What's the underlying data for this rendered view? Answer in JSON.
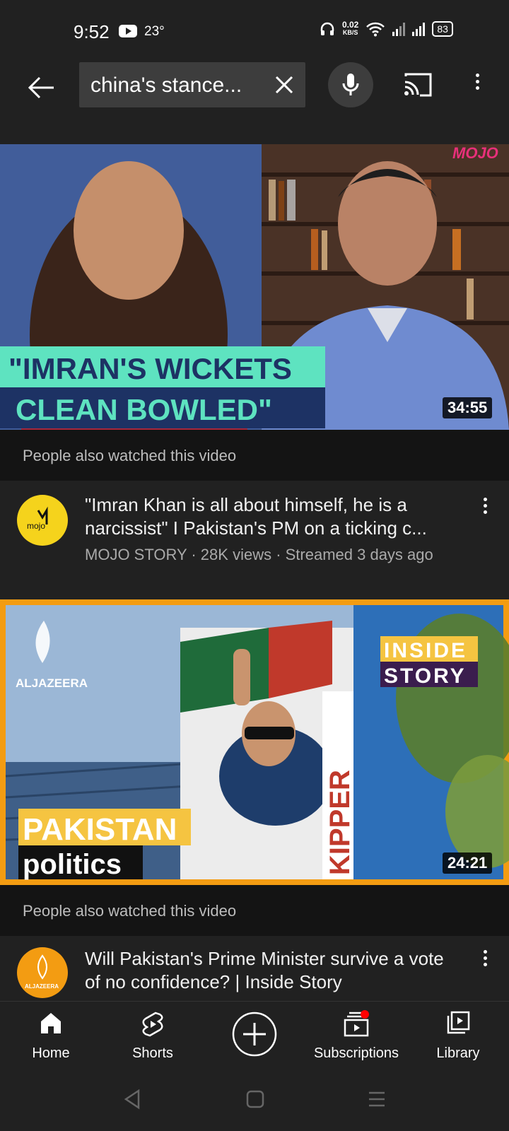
{
  "status_bar": {
    "time": "9:52",
    "temperature": "23°",
    "net_speed_value": "0.02",
    "net_speed_unit": "KB/S",
    "battery": "83"
  },
  "search": {
    "query": "china's stance...",
    "clear_icon": "close-icon",
    "mic_icon": "mic-icon"
  },
  "videos": [
    {
      "thumb_badge": "MOJO",
      "thumb_caption_line1": "\"IMRAN'S WICKETS",
      "thumb_caption_line2": "CLEAN BOWLED\"",
      "duration": "34:55",
      "also_watched": "People also watched this video",
      "avatar_text": "mojo",
      "title": "\"Imran Khan is all about himself, he is a narcissist\" I Pakistan's PM on a ticking c...",
      "meta": "MOJO STORY · 28K views · Streamed 3 days ago"
    },
    {
      "thumb_logo": "ALJAZEERA",
      "thumb_show_line1": "INSIDE",
      "thumb_show_line2": "STORY",
      "thumb_caption_line1": "PAKISTAN",
      "thumb_caption_line2": "politics",
      "thumb_banner_text": "KIPPER",
      "duration": "24:21",
      "also_watched": "People also watched this video",
      "avatar_text": "ALJAZEERA",
      "title": "Will Pakistan's Prime Minister survive a vote of no confidence? | Inside Story"
    }
  ],
  "bottom_nav": [
    {
      "label": "Home",
      "icon": "home-icon"
    },
    {
      "label": "Shorts",
      "icon": "shorts-icon"
    },
    {
      "label": "",
      "icon": "create-icon"
    },
    {
      "label": "Subscriptions",
      "icon": "subscriptions-icon"
    },
    {
      "label": "Library",
      "icon": "library-icon"
    }
  ],
  "colors": {
    "background": "#212121",
    "accent_orange": "#f39c12",
    "notification_red": "#ff0000"
  }
}
